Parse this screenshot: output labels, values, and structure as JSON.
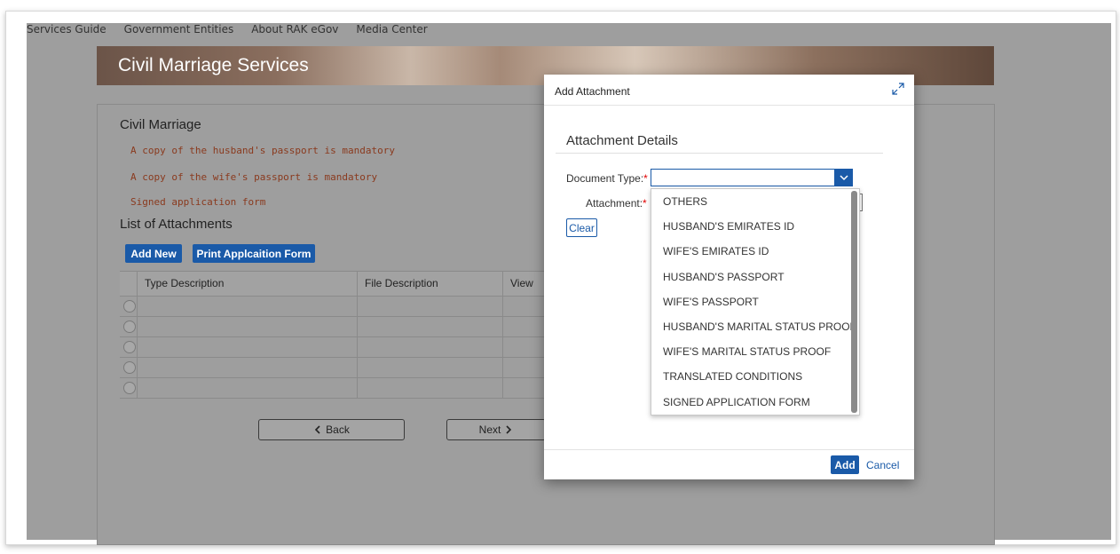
{
  "topnav": {
    "items": [
      "Services Guide",
      "Government Entities",
      "About RAK eGov",
      "Media Center"
    ]
  },
  "banner": {
    "title": "Civil Marriage Services"
  },
  "form": {
    "section_title": "Civil Marriage",
    "requirements": [
      "A copy of the husband's passport is mandatory",
      "A copy of the wife's passport is mandatory",
      "Signed application form"
    ],
    "list_title": "List of Attachments",
    "add_new_label": "Add New",
    "print_label": "Print Applcaition Form",
    "table": {
      "headers": [
        "Type Description",
        "File Description",
        "View"
      ],
      "row_count": 5
    },
    "back_label": "Back",
    "next_label": "Next"
  },
  "dialog": {
    "title": "Add Attachment",
    "details_title": "Attachment Details",
    "document_type_label": "Document Type:",
    "attachment_label": "Attachment:",
    "required_mark": "*",
    "clear_label": "Clear",
    "document_type_value": "",
    "options": [
      "OTHERS",
      "HUSBAND'S EMIRATES ID",
      "WIFE'S EMIRATES ID",
      "HUSBAND'S PASSPORT",
      "WIFE'S PASSPORT",
      "HUSBAND'S MARITAL STATUS PROOF",
      "WIFE'S MARITAL STATUS PROOF",
      "TRANSLATED CONDITIONS",
      "SIGNED APPLICATION FORM"
    ],
    "add_label": "Add",
    "cancel_label": "Cancel"
  },
  "colors": {
    "accent": "#1a5aa8",
    "required": "#e00000",
    "requirement_text": "#8a3a1e",
    "overlay": "#9e9e9e"
  },
  "icons": [
    "maximize-icon",
    "chevron-down-icon",
    "chevron-left-icon",
    "chevron-right-icon"
  ]
}
